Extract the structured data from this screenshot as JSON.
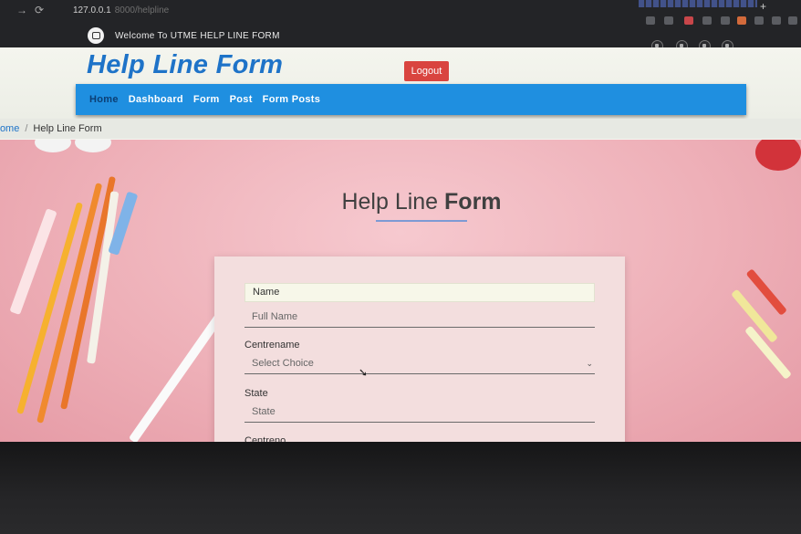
{
  "browser": {
    "url": "127.0.0.1",
    "url_rest": "8000/helpline",
    "new_tab": "+"
  },
  "topbar": {
    "welcome": "Welcome To UTME HELP LINE FORM"
  },
  "header": {
    "brand": "Help Line Form",
    "logout": "Logout",
    "nav": [
      "Home",
      "Dashboard",
      "Form",
      "Post",
      "Form Posts"
    ]
  },
  "breadcrumb": {
    "home": "Home",
    "sep": "/",
    "current": "Help Line Form"
  },
  "hero": {
    "title_light": "Help Line ",
    "title_bold": "Form"
  },
  "form": {
    "name_label": "Name",
    "name_placeholder": "Full Name",
    "centre_label": "Centrename",
    "centre_value": "Select Choice",
    "state_label": "State",
    "state_placeholder": "State",
    "centreno_label": "Centreno"
  },
  "colors": {
    "accent": "#1f8fe0",
    "brand": "#1e73c8",
    "logout": "#d9443f",
    "hero": "#eeb0b8"
  }
}
